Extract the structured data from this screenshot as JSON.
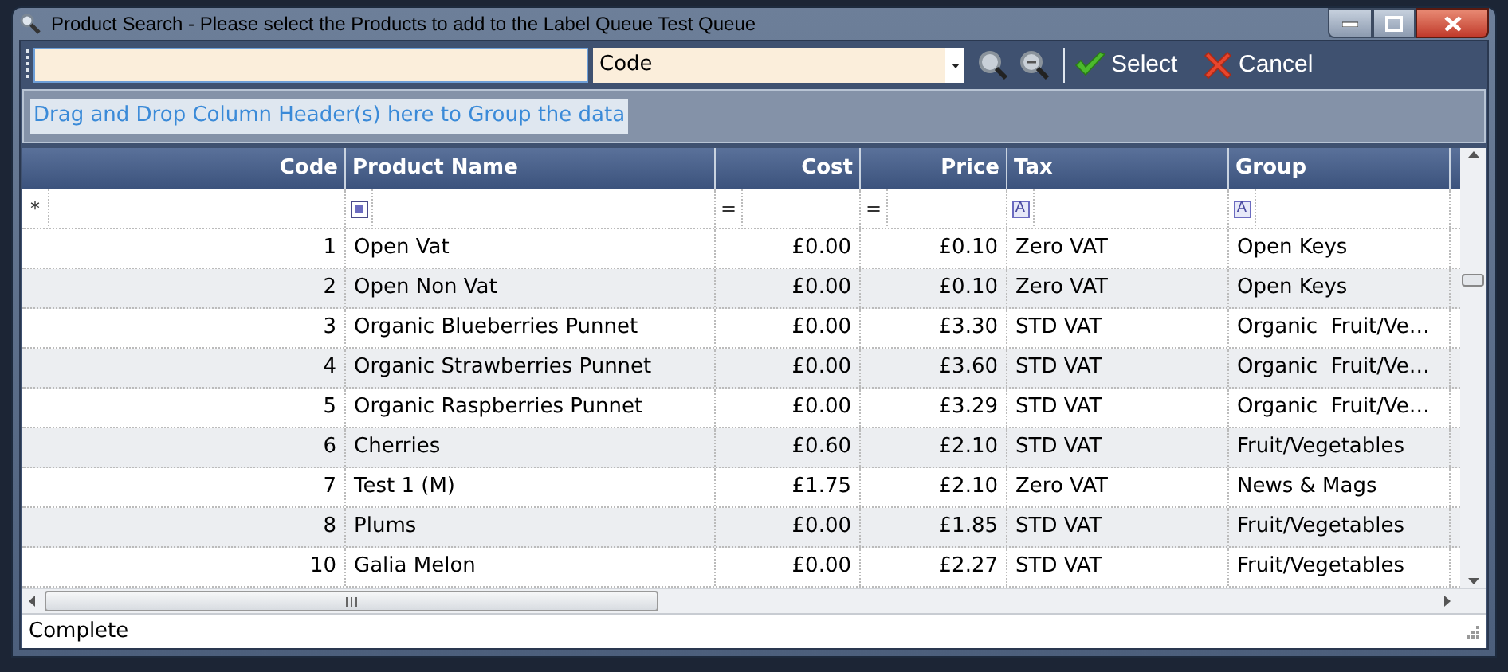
{
  "window": {
    "title": "Product Search - Please select the Products to add to the Label Queue Test Queue"
  },
  "toolbar": {
    "field_dropdown": {
      "value": "Code"
    },
    "buttons": [
      {
        "kind": "select",
        "label": "Select"
      },
      {
        "kind": "cancel",
        "label": "Cancel"
      }
    ]
  },
  "group_panel": {
    "hint": "Drag and Drop Column Header(s) here to Group the data"
  },
  "table": {
    "columns": [
      {
        "label": "Code",
        "filter": {
          "kind": "text",
          "text": "*"
        }
      },
      {
        "label": "Product Name",
        "filter": {
          "kind": "square"
        }
      },
      {
        "label": "Cost",
        "filter": {
          "kind": "text",
          "text": "="
        }
      },
      {
        "label": "Price",
        "filter": {
          "kind": "text",
          "text": "="
        }
      },
      {
        "label": "Tax",
        "filter": {
          "kind": "letter",
          "text": "A"
        }
      },
      {
        "label": "Group",
        "filter": {
          "kind": "letter",
          "text": "A"
        }
      }
    ],
    "rows": [
      [
        "1",
        "Open Vat",
        "£0.00",
        "£0.10",
        "Zero VAT",
        "Open Keys"
      ],
      [
        "2",
        "Open Non Vat",
        "£0.00",
        "£0.10",
        "Zero VAT",
        "Open Keys"
      ],
      [
        "3",
        "Organic Blueberries Punnet",
        "£0.00",
        "£3.30",
        "STD VAT",
        "Organic  Fruit/Ve…"
      ],
      [
        "4",
        "Organic Strawberries Punnet",
        "£0.00",
        "£3.60",
        "STD VAT",
        "Organic  Fruit/Ve…"
      ],
      [
        "5",
        "Organic Raspberries Punnet",
        "£0.00",
        "£3.29",
        "STD VAT",
        "Organic  Fruit/Ve…"
      ],
      [
        "6",
        "Cherries",
        "£0.60",
        "£2.10",
        "STD VAT",
        "Fruit/Vegetables"
      ],
      [
        "7",
        "Test 1 (M)",
        "£1.75",
        "£2.10",
        "Zero VAT",
        "News & Mags"
      ],
      [
        "8",
        "Plums",
        "£0.00",
        "£1.85",
        "STD VAT",
        "Fruit/Vegetables"
      ],
      [
        "10",
        "Galia Melon",
        "£0.00",
        "£2.27",
        "STD VAT",
        "Fruit/Vegetables"
      ]
    ]
  },
  "status_bar": {
    "text": "Complete"
  }
}
